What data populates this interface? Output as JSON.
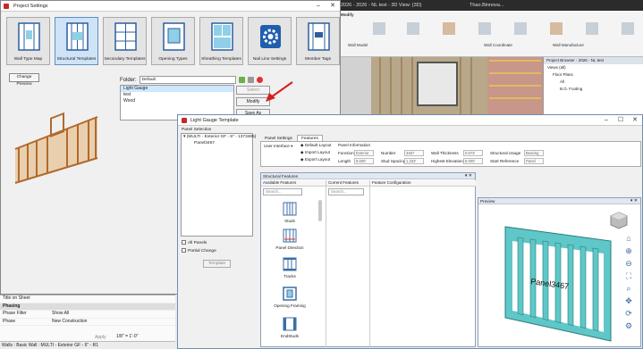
{
  "revit": {
    "title": "2026 - 2026 - NL test - 3D View: {3D}",
    "user": "Thao.Binnova...",
    "ribbon_tab": "Modify",
    "ribbon_labels": [
      "Wall Model",
      "Wall Coordinate",
      "Wall Manufacture"
    ],
    "project_browser": {
      "title": "Project Browser - 2026 - NL test",
      "items": [
        "Views (all)",
        "Floor Plans",
        "All",
        "B.O. Footing"
      ]
    },
    "properties": {
      "rows": [
        {
          "label": "Title on Sheet",
          "value": ""
        },
        {
          "label": "Phasing",
          "value": "",
          "header": true
        },
        {
          "label": "Phase Filter",
          "value": "Show All"
        },
        {
          "label": "Phase",
          "value": "New Construction"
        }
      ],
      "apply_label": "Apply"
    },
    "view_scale": "1/8\" = 1'-0\"",
    "status_text": "Walls : Basic Wall : MULTI - Exterior GF - 6\" - R1"
  },
  "project_settings": {
    "title": "Project Settings",
    "tabs": [
      {
        "label": "Wall Type Map",
        "icon": "wall-type-map-icon"
      },
      {
        "label": "Structural Templates",
        "icon": "structural-templates-icon"
      },
      {
        "label": "Secondary Templates",
        "icon": "secondary-templates-icon"
      },
      {
        "label": "Opening Types",
        "icon": "opening-types-icon"
      },
      {
        "label": "Sheathing Templates",
        "icon": "sheathing-templates-icon"
      },
      {
        "label": "Nail Line Settings",
        "icon": "gear-icon"
      },
      {
        "label": "Member Tags",
        "icon": "member-tags-icon"
      }
    ],
    "change_preview_label": "Change Preview",
    "folder_label": "Folder:",
    "folder_value": "Default",
    "templates": [
      "Light Gauge",
      "test",
      "Wood"
    ],
    "selected_template": "Light Gauge",
    "buttons": {
      "select": "Select",
      "modify": "Modify",
      "save_as": "Save As"
    }
  },
  "light_gauge": {
    "title": "Light Gauge Template",
    "panel_selection_label": "Panel Selection",
    "tree": {
      "parent": "(MULTI - Exterior GF - 6\" - 1373485)",
      "child": "Panel3467"
    },
    "all_panels_label": "All Panels",
    "partial_change_label": "Partial Change",
    "template_button": "Template",
    "tabs": [
      "Panel Settings",
      "Features"
    ],
    "active_tab": "Features",
    "user_interface_label": "User Interface",
    "layout_buttons": [
      "Default Layout",
      "Import Layout",
      "Export Layout"
    ],
    "panel_information_label": "Panel Information",
    "info": {
      "function_label": "Function",
      "function_value": "Exterior",
      "length_label": "Length",
      "length_value": "8.000'",
      "number_label": "Number",
      "number_value": "3467",
      "stud_spacing_label": "Stud Spacing",
      "stud_spacing_value": "1.333'",
      "wall_thickness_label": "Wall Thickness",
      "wall_thickness_value": "0.573'",
      "highest_elevation_label": "Highest Elevation",
      "highest_elevation_value": "8.000'",
      "structural_usage_label": "Structural Usage",
      "structural_usage_value": "Bearing",
      "start_reference_label": "Start Reference",
      "start_reference_value": "Panel"
    },
    "structural_features_title": "Structural Features",
    "columns": [
      "Available Features",
      "Current Features",
      "Feature Configuration"
    ],
    "search_placeholder": "Search...",
    "features": [
      {
        "label": "Studs",
        "icon": "studs-icon"
      },
      {
        "label": "Panel Direction",
        "icon": "panel-direction-icon"
      },
      {
        "label": "Tracks",
        "icon": "tracks-icon"
      },
      {
        "label": "Opening Framing",
        "icon": "opening-framing-icon"
      },
      {
        "label": "EndStuds",
        "icon": "endstuds-icon"
      }
    ],
    "preview_title": "Preview",
    "preview_tag": "Panel3467"
  },
  "colors": {
    "accent": "#5b8fc7",
    "panel_teal": "#5fc7c7",
    "brand_red": "#c62828",
    "arrow_red": "#d42020"
  }
}
